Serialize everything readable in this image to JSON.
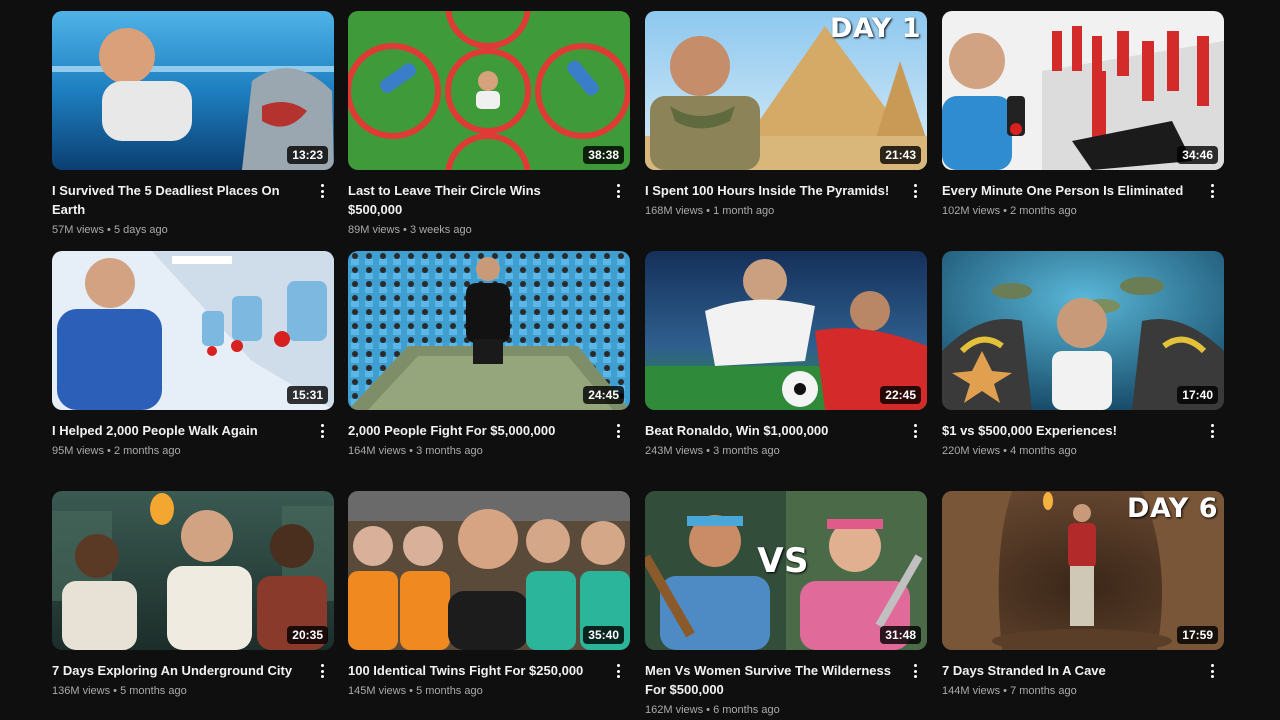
{
  "videos": [
    {
      "title": "I Survived The 5 Deadliest Places On Earth",
      "views": "57M views",
      "age": "5 days ago",
      "duration": "13:23",
      "overlay": ""
    },
    {
      "title": "Last to Leave Their Circle Wins $500,000",
      "views": "89M views",
      "age": "3 weeks ago",
      "duration": "38:38",
      "overlay": ""
    },
    {
      "title": "I Spent 100 Hours Inside The Pyramids!",
      "views": "168M views",
      "age": "1 month ago",
      "duration": "21:43",
      "overlay": "DAY 1"
    },
    {
      "title": "Every Minute One Person Is Eliminated",
      "views": "102M views",
      "age": "2 months ago",
      "duration": "34:46",
      "overlay": ""
    },
    {
      "title": "I Helped 2,000 People Walk Again",
      "views": "95M views",
      "age": "2 months ago",
      "duration": "15:31",
      "overlay": ""
    },
    {
      "title": "2,000 People Fight For $5,000,000",
      "views": "164M views",
      "age": "3 months ago",
      "duration": "24:45",
      "overlay": ""
    },
    {
      "title": "Beat Ronaldo, Win $1,000,000",
      "views": "243M views",
      "age": "3 months ago",
      "duration": "22:45",
      "overlay": ""
    },
    {
      "title": "$1 vs $500,000 Experiences!",
      "views": "220M views",
      "age": "4 months ago",
      "duration": "17:40",
      "overlay": ""
    },
    {
      "title": "7 Days Exploring An Underground City",
      "views": "136M views",
      "age": "5 months ago",
      "duration": "20:35",
      "overlay": ""
    },
    {
      "title": "100 Identical Twins Fight For $250,000",
      "views": "145M views",
      "age": "5 months ago",
      "duration": "35:40",
      "overlay": ""
    },
    {
      "title": "Men Vs Women Survive The Wilderness For $500,000",
      "views": "162M views",
      "age": "6 months ago",
      "duration": "31:48",
      "overlay": "VS"
    },
    {
      "title": "7 Days Stranded In A Cave",
      "views": "144M views",
      "age": "7 months ago",
      "duration": "17:59",
      "overlay": "DAY 6"
    }
  ],
  "separator": "•",
  "colors": {
    "background": "#0f0f0f",
    "title": "#f1f1f1",
    "meta": "#aaaaaa"
  }
}
